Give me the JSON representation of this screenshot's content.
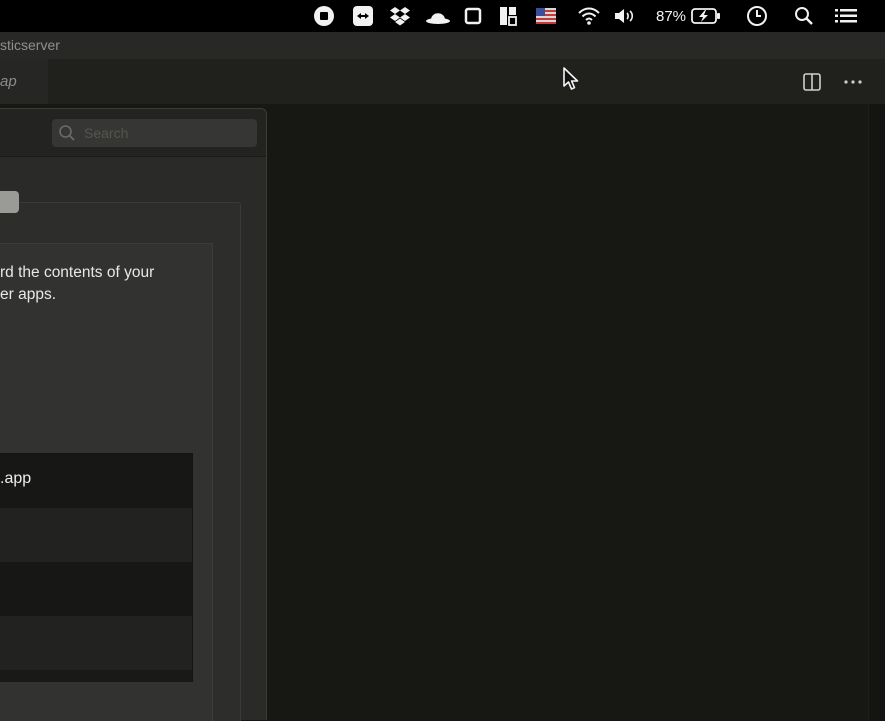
{
  "menubar": {
    "battery_percent_label": "87%",
    "icons": [
      "record-icon",
      "teamviewer-icon",
      "dropbox-icon",
      "bowler-hat-icon",
      "square-icon",
      "grid-layout-icon",
      "flag-icon",
      "wifi-icon",
      "volume-icon",
      "battery-charging-icon",
      "clock-icon",
      "search-icon",
      "list-icon"
    ]
  },
  "window": {
    "title": "sticserver"
  },
  "tabs": [
    {
      "label": "ap"
    }
  ],
  "toolbar_icons": [
    "split-editor-icon",
    "more-icon"
  ],
  "panel": {
    "search_placeholder": "Search",
    "description_line1": "rd the contents of your",
    "description_line2": "er apps.",
    "apps": [
      {
        "label": ".app"
      },
      {
        "label": ""
      },
      {
        "label": ""
      },
      {
        "label": ""
      }
    ]
  },
  "colors": {
    "background": "#141412",
    "panel": "#2a2a28",
    "text": "#e8e8e6"
  }
}
